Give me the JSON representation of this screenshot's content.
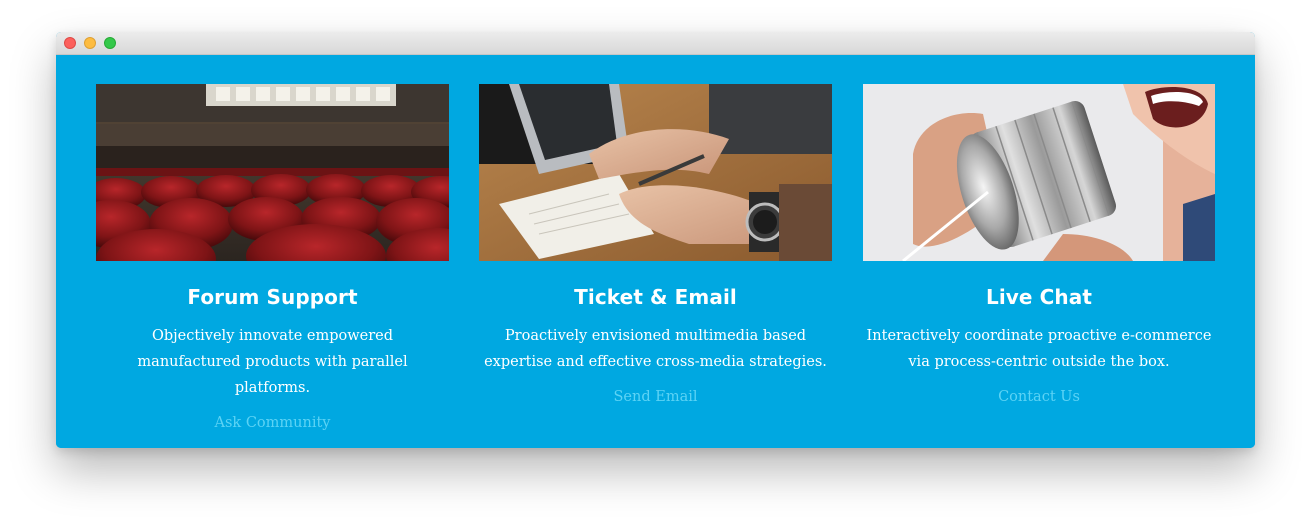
{
  "window": {
    "controls": [
      "close",
      "minimize",
      "maximize"
    ]
  },
  "colors": {
    "background": "#00a8e1",
    "title": "#ffffff",
    "link": "#5cd3f5"
  },
  "cards": [
    {
      "title": "Forum Support",
      "description": "Objectively innovate empowered manufactured products with parallel platforms.",
      "link": "Ask Community"
    },
    {
      "title": "Ticket & Email",
      "description": "Proactively envisioned multimedia based expertise and effective cross-media strategies.",
      "link": "Send Email"
    },
    {
      "title": "Live Chat",
      "description": "Interactively coordinate proactive e-commerce via process-centric outside the box.",
      "link": "Contact Us"
    }
  ]
}
